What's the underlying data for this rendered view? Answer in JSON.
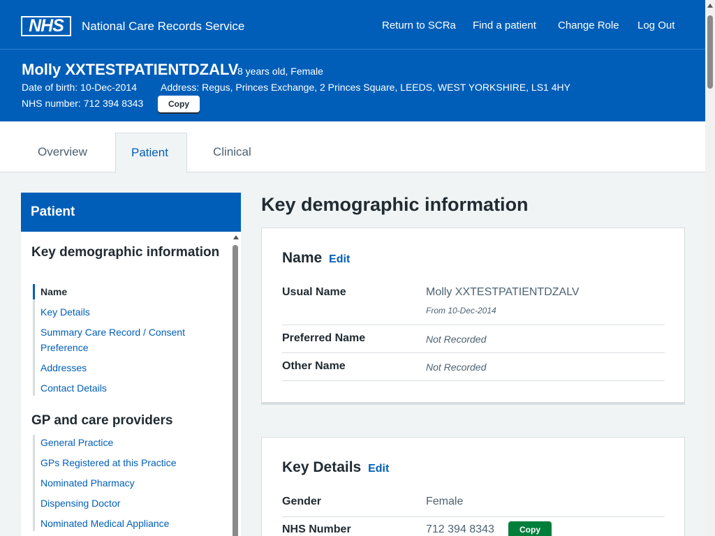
{
  "header": {
    "logo_text": "NHS",
    "service_name": "National Care Records Service",
    "nav": [
      "Return to SCRa",
      "Find a patient",
      "Change Role",
      "Log Out"
    ]
  },
  "patient": {
    "name": "Molly XXTESTPATIENTDZALV",
    "age_gender": "8 years old, Female",
    "dob": "Date of birth: 10-Dec-2014",
    "address": "Address: Regus, Princes Exchange, 2 Princes Square, LEEDS, WEST YORKSHIRE, LS1 4HY",
    "nhs_number": "NHS number: 712 394 8343",
    "copy_label": "Copy"
  },
  "tabs": [
    {
      "label": "Overview",
      "active": false
    },
    {
      "label": "Patient",
      "active": true
    },
    {
      "label": "Clinical",
      "active": false
    }
  ],
  "sidebar": {
    "title": "Patient",
    "sections": [
      {
        "title": "Key demographic information",
        "items": [
          {
            "label": "Name",
            "active": true
          },
          {
            "label": "Key Details"
          },
          {
            "label": "Summary Care Record / Consent Preference"
          },
          {
            "label": "Addresses"
          },
          {
            "label": "Contact Details"
          }
        ]
      },
      {
        "title": "GP and care providers",
        "items": [
          {
            "label": "General Practice"
          },
          {
            "label": "GPs Registered at this Practice"
          },
          {
            "label": "Nominated Pharmacy"
          },
          {
            "label": "Dispensing Doctor"
          },
          {
            "label": "Nominated Medical Appliance"
          }
        ]
      }
    ]
  },
  "main": {
    "title": "Key demographic information",
    "edit_label": "Edit",
    "name_card": {
      "title": "Name",
      "usual_name_label": "Usual Name",
      "usual_name_value": "Molly XXTESTPATIENTDZALV",
      "usual_name_from": "From 10-Dec-2014",
      "preferred_name_label": "Preferred Name",
      "preferred_name_value": "Not Recorded",
      "other_name_label": "Other Name",
      "other_name_value": "Not Recorded"
    },
    "key_details_card": {
      "title": "Key Details",
      "gender_label": "Gender",
      "gender_value": "Female",
      "nhs_number_label": "NHS Number",
      "nhs_number_value": "712 394 8343",
      "copy_label": "Copy"
    }
  }
}
